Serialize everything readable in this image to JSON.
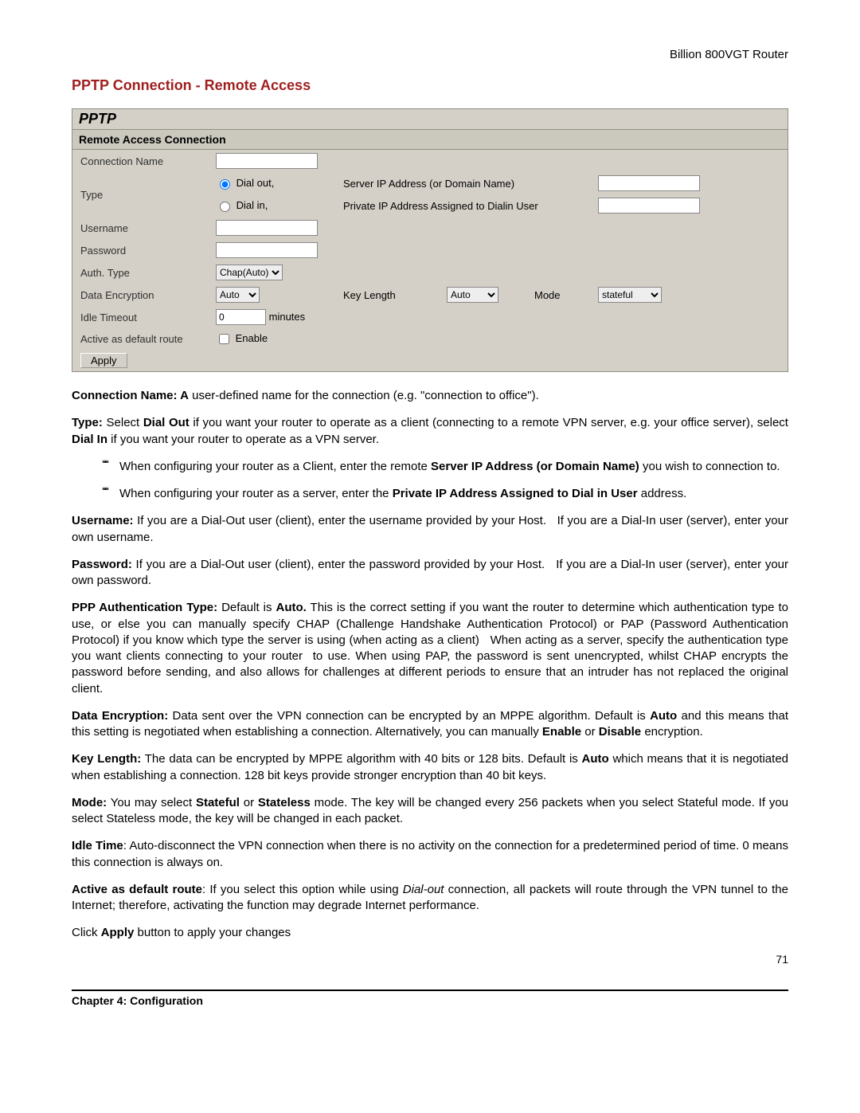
{
  "header": {
    "device": "Billion 800VGT Router"
  },
  "title": "PPTP Connection - Remote Access",
  "panel": {
    "title": "PPTP",
    "subtitle": "Remote Access Connection",
    "labels": {
      "connName": "Connection Name",
      "type": "Type",
      "dialOut": "Dial out,",
      "dialIn": "Dial in,",
      "serverIP": "Server IP Address (or Domain Name)",
      "privateIP": "Private IP Address Assigned to Dialin User",
      "username": "Username",
      "password": "Password",
      "authType": "Auth. Type",
      "dataEnc": "Data Encryption",
      "keyLength": "Key Length",
      "mode": "Mode",
      "idle": "Idle Timeout",
      "minutes": "minutes",
      "active": "Active as default route",
      "enable": "Enable",
      "apply": "Apply"
    },
    "values": {
      "connName": "",
      "serverIP": "",
      "privateIP": "",
      "username": "",
      "password": "",
      "authType": "Chap(Auto)",
      "dataEnc": "Auto",
      "keyLength": "Auto",
      "mode": "stateful",
      "idle": "0"
    }
  },
  "descr": {
    "p1a": "Connection Name: A",
    "p1b": " user-defined name for the connection (e.g. \"connection to office\").",
    "p2": "Type: Select Dial Out if you want your router to operate as a client (connecting to a remote VPN server, e.g. your office server), select Dial In if you want your router to operate as a VPN server.",
    "b1": "When configuring your router as a Client, enter the remote Server IP Address (or Domain Name) you wish to connection to.",
    "b2": "When configuring your router as a server, enter the Private IP Address Assigned to Dial in User address.",
    "p3": "Username: If you are a Dial-Out user (client), enter the username provided by your Host.   If you are a Dial-In user (server), enter your own username.",
    "p4": "Password: If you are a Dial-Out user (client), enter the password provided by your Host.   If you are a Dial-In user (server), enter your own password.",
    "p5": "PPP Authentication Type: Default is Auto. This is the correct setting if you want the router to determine which authentication type to use, or else you can manually specify CHAP (Challenge Handshake Authentication Protocol) or PAP (Password Authentication Protocol) if you know which type the server is using (when acting as a client)   When acting as a server, specify the authentication type you want clients connecting to your router  to use. When using PAP, the password is sent unencrypted, whilst CHAP encrypts the password before sending, and also allows for challenges at different periods to ensure that an intruder has not replaced the original client.",
    "p6": "Data Encryption: Data sent over the VPN connection can be encrypted by an MPPE algorithm. Default is Auto and this means that this setting is negotiated when establishing a connection. Alternatively, you can manually Enable or Disable encryption.",
    "p7": "Key Length: The data can be encrypted by MPPE algorithm with 40 bits or 128 bits. Default is Auto which means that it is negotiated when establishing a connection. 128 bit keys provide stronger encryption than 40 bit keys.",
    "p8": "Mode: You may select Stateful or Stateless mode. The key will be changed every 256 packets when you select Stateful mode. If you select Stateless mode, the key will be changed in each packet.",
    "p9": "Idle Time: Auto-disconnect the VPN connection when there is no activity on the connection for a predetermined period of time. 0 means this connection is always on.",
    "p10": "Active as default route: If you select this option while using Dial-out connection, all packets will route through the VPN tunnel to the Internet; therefore, activating the function may degrade Internet performance.",
    "p11": "Click Apply button to apply your changes"
  },
  "footer": {
    "chapter": "Chapter 4: Configuration",
    "page": "71"
  }
}
